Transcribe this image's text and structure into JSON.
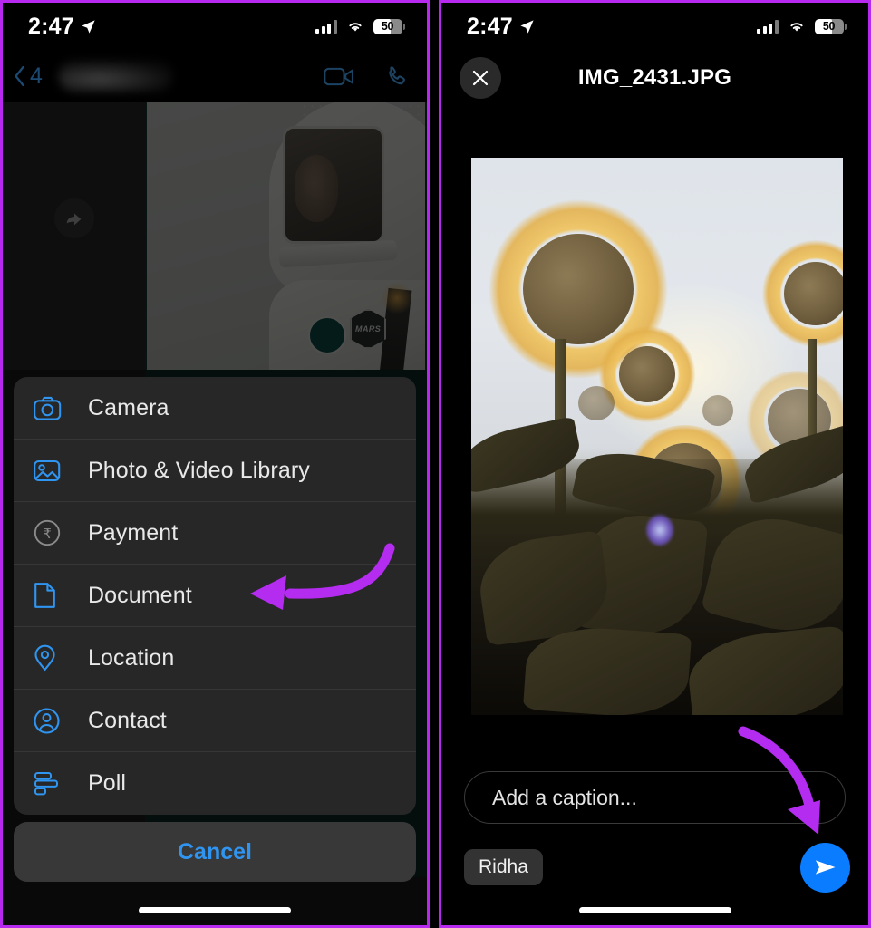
{
  "left_panel": {
    "status_bar": {
      "time": "2:47",
      "location_icon": "location-arrow-icon",
      "signal_icon": "cellular-bars-icon",
      "wifi_icon": "wifi-icon",
      "battery_level": "50"
    },
    "nav_bar": {
      "back_icon": "chevron-left-icon",
      "unread_count": "4",
      "contact_name": "",
      "video_icon": "video-camera-icon",
      "call_icon": "phone-icon"
    },
    "chat": {
      "share_icon": "share-arrow-icon",
      "photo_alt": "astronaut-photo",
      "patch_text": "MARS"
    },
    "action_sheet": {
      "items": [
        {
          "label": "Camera",
          "icon": "camera-icon"
        },
        {
          "label": "Photo & Video Library",
          "icon": "photo-library-icon"
        },
        {
          "label": "Payment",
          "icon": "rupee-payment-icon"
        },
        {
          "label": "Document",
          "icon": "document-icon"
        },
        {
          "label": "Location",
          "icon": "location-pin-icon"
        },
        {
          "label": "Contact",
          "icon": "contact-person-icon"
        },
        {
          "label": "Poll",
          "icon": "poll-bars-icon"
        }
      ],
      "cancel_label": "Cancel"
    }
  },
  "right_panel": {
    "status_bar": {
      "time": "2:47",
      "location_icon": "location-arrow-icon",
      "signal_icon": "cellular-bars-icon",
      "wifi_icon": "wifi-icon",
      "battery_level": "50"
    },
    "header": {
      "close_icon": "close-x-icon",
      "title": "IMG_2431.JPG"
    },
    "photo": {
      "alt": "sunflower-field-photo"
    },
    "caption": {
      "placeholder": "Add a caption..."
    },
    "recipient": {
      "name": "Ridha"
    },
    "send": {
      "icon": "send-paper-plane-icon"
    }
  },
  "annotations": {
    "arrow_color": "#b42cf0",
    "left_arrow_target": "Document",
    "right_arrow_target": "send-button"
  },
  "colors": {
    "accent_blue": "#0a7cff",
    "icon_blue": "#2f95f0",
    "sheet_bg": "#282828",
    "border_purple": "#b829f0"
  }
}
